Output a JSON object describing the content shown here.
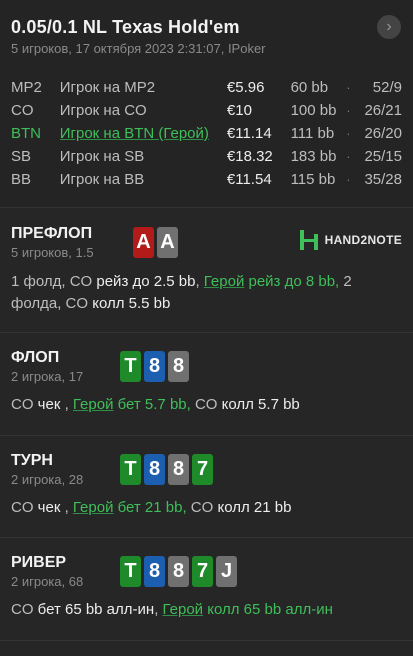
{
  "header": {
    "title": "0.05/0.1 NL Texas Hold'em",
    "subtitle": "5 игроков, 17 октября 2023 2:31:07, IPoker",
    "nav_icon": "chevron-right-icon"
  },
  "players": [
    {
      "pos": "MP2",
      "name": "Игрок на MP2",
      "stack": "€5.96",
      "bb": "60 bb",
      "stat": "52/9",
      "hero": false
    },
    {
      "pos": "CO",
      "name": "Игрок на CO",
      "stack": "€10",
      "bb": "100 bb",
      "stat": "26/21",
      "hero": false
    },
    {
      "pos": "BTN",
      "name": "Игрок на BTN (Герой)",
      "stack": "€11.14",
      "bb": "111 bb",
      "stat": "26/20",
      "hero": true
    },
    {
      "pos": "SB",
      "name": "Игрок на SB",
      "stack": "€18.32",
      "bb": "183 bb",
      "stat": "25/15",
      "hero": false
    },
    {
      "pos": "BB",
      "name": "Игрок на BB",
      "stack": "€11.54",
      "bb": "115 bb",
      "stat": "35/28",
      "hero": false
    }
  ],
  "colors": {
    "hero": "#3fbf5a",
    "card_red": "#b31a1a",
    "card_gray": "#707070",
    "card_green": "#1e8a2a",
    "card_blue": "#1c5fb0"
  },
  "logo": {
    "text": "HAND2NOTE"
  },
  "preflop": {
    "name": "ПРЕФЛОП",
    "sub": "5 игроков, 1.5",
    "cards": [
      "A",
      "A"
    ],
    "a1": "1 фолд, CO ",
    "a2": "рейз до 2.5 bb",
    "a3": ", ",
    "a4": "Герой",
    "a5": " рейз до 8 bb,",
    "a6": " 2 фолда, CO ",
    "a7": "колл 5.5 bb"
  },
  "flop": {
    "name": "ФЛОП",
    "sub": "2 игрока, 17",
    "cards": [
      "T",
      "8",
      "8"
    ],
    "a1": "CO ",
    "a2": "чек",
    "a3": " , ",
    "a4": "Герой",
    "a5": " бет 5.7 bb,",
    "a6": " CO ",
    "a7": "колл 5.7 bb"
  },
  "turn": {
    "name": "ТУРН",
    "sub": "2 игрока, 28",
    "cards": [
      "T",
      "8",
      "8",
      "7"
    ],
    "a1": "CO ",
    "a2": "чек",
    "a3": " , ",
    "a4": "Герой",
    "a5": " бет 21 bb,",
    "a6": " CO ",
    "a7": "колл 21 bb"
  },
  "river": {
    "name": "РИВЕР",
    "sub": "2 игрока, 68",
    "cards": [
      "T",
      "8",
      "8",
      "7",
      "J"
    ],
    "a1": "CO ",
    "a2": "бет 65 bb алл-ин",
    "a3": ", ",
    "a4": "Герой",
    "a5": " колл 65 bb алл-ин"
  }
}
